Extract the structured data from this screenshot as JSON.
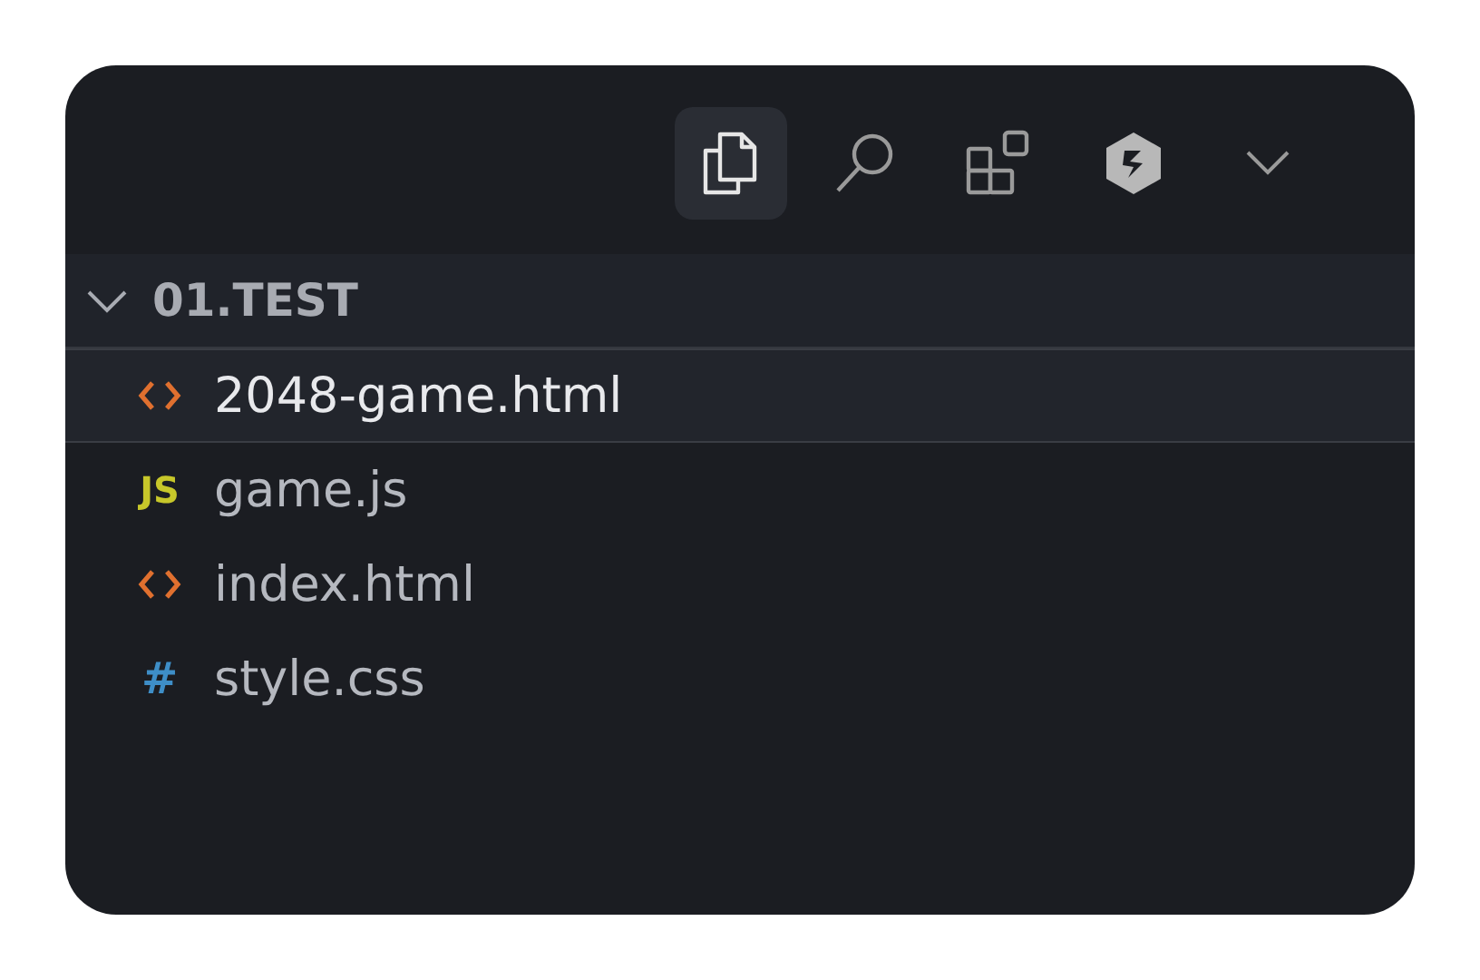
{
  "toolbar": [
    {
      "kind": "explorer",
      "selected": true
    },
    {
      "kind": "search",
      "selected": false
    },
    {
      "kind": "extensions",
      "selected": false
    },
    {
      "kind": "plugin",
      "selected": false
    },
    {
      "kind": "more",
      "selected": false
    }
  ],
  "folder": {
    "name": "01.TEST",
    "expanded": true
  },
  "files": [
    {
      "name": "2048-game.html",
      "kind": "html",
      "selected": true
    },
    {
      "name": "game.js",
      "kind": "js",
      "icon_text": "JS",
      "selected": false
    },
    {
      "name": "index.html",
      "kind": "html",
      "selected": false
    },
    {
      "name": "style.css",
      "kind": "css",
      "icon_text": "#",
      "selected": false
    }
  ]
}
